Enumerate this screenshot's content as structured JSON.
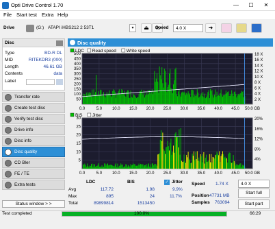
{
  "window": {
    "title": "Opti Drive Control 1.70",
    "min": "—",
    "max": "☐",
    "close": "✕"
  },
  "menu": [
    "File",
    "Start test",
    "Extra",
    "Help"
  ],
  "drive": {
    "label": "Drive",
    "letter": "(G:)",
    "name": "ATAPI iHBS212  2 53T1",
    "speed_label": "Speed",
    "speed": "4.0 X"
  },
  "disc": {
    "header": "Disc",
    "rows": [
      {
        "key": "Type",
        "val": "BD-R DL"
      },
      {
        "key": "MID",
        "val": "RITEKDR3 (000)"
      },
      {
        "key": "Length",
        "val": "46.61 GB"
      },
      {
        "key": "Contents",
        "val": "data"
      },
      {
        "key": "Label",
        "val": ""
      }
    ]
  },
  "nav": [
    "Transfer rate",
    "Create test disc",
    "Verify test disc",
    "Drive info",
    "Disc info",
    "Disc quality",
    "CD Bler",
    "FE / TE",
    "Extra tests"
  ],
  "status_window": "Status window > >",
  "panel_title": "Disc quality",
  "chart1": {
    "legend": [
      "LDC",
      "Read speed",
      "Write speed"
    ],
    "y_left": [
      "500",
      "450",
      "400",
      "350",
      "300",
      "250",
      "200",
      "150",
      "100",
      "50"
    ],
    "y_right": [
      "18 X",
      "16 X",
      "14 X",
      "12 X",
      "10 X",
      "8 X",
      "6 X",
      "4 X",
      "2 X"
    ],
    "x": [
      "0.0",
      "5.0",
      "10.0",
      "15.0",
      "20.0",
      "25.0",
      "30.0",
      "35.0",
      "40.0",
      "45.0",
      "50.0 GB"
    ]
  },
  "chart2": {
    "legend": [
      "BIS",
      "Jitter"
    ],
    "y_left": [
      "30",
      "25",
      "20",
      "15",
      "10",
      "5"
    ],
    "y_right": [
      "20%",
      "16%",
      "12%",
      "8%",
      "4%"
    ],
    "x": [
      "0.0",
      "5.0",
      "10.0",
      "15.0",
      "20.0",
      "25.0",
      "30.0",
      "35.0",
      "40.0",
      "45.0",
      "50.0 GB"
    ]
  },
  "stats": {
    "cols": [
      "LDC",
      "BIS"
    ],
    "rows": [
      {
        "key": "Avg",
        "ldc": "117.72",
        "bis": "1.98"
      },
      {
        "key": "Max",
        "ldc": "895",
        "bis": "24"
      },
      {
        "key": "Total",
        "ldc": "89899814",
        "bis": "1513450"
      }
    ],
    "jitter_label": "Jitter",
    "jitter_avg": "9.9%",
    "jitter_max": "11.7%",
    "speed_label": "Speed",
    "speed_val": "1.74 X",
    "position_label": "Position",
    "position_val": "47731 MB",
    "samples_label": "Samples",
    "samples_val": "763094",
    "speed_select": "4.0 X",
    "start_full": "Start full",
    "start_part": "Start part"
  },
  "statusbar": {
    "text": "Test completed",
    "progress_pct": 100,
    "progress_text": "100.0%",
    "time": "66:29"
  },
  "colors": {
    "ldc": "#00c000",
    "bis": "#00c000",
    "read": "#ffffff",
    "jitter": "#ffffff",
    "accent": "#2d8fd6",
    "bis_spike": "#e6e600"
  }
}
